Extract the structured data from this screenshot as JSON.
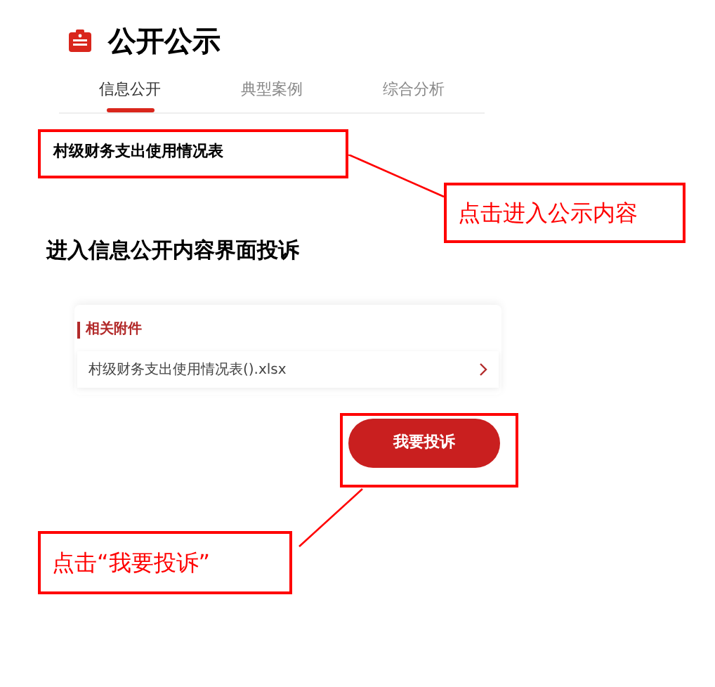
{
  "header": {
    "title": "公开公示"
  },
  "tabs": [
    {
      "label": "信息公开",
      "selected": true
    },
    {
      "label": "典型案例",
      "selected": false
    },
    {
      "label": "综合分析",
      "selected": false
    }
  ],
  "list_item": {
    "title": "村级财务支出使用情况表"
  },
  "callouts": [
    "点击进入公示内容",
    "点击“我要投诉”"
  ],
  "heading": "进入信息公开内容界面投诉",
  "attachments": {
    "title": "相关附件",
    "files": [
      "村级财务支出使用情况表().xlsx"
    ]
  },
  "button": "我要投诉"
}
